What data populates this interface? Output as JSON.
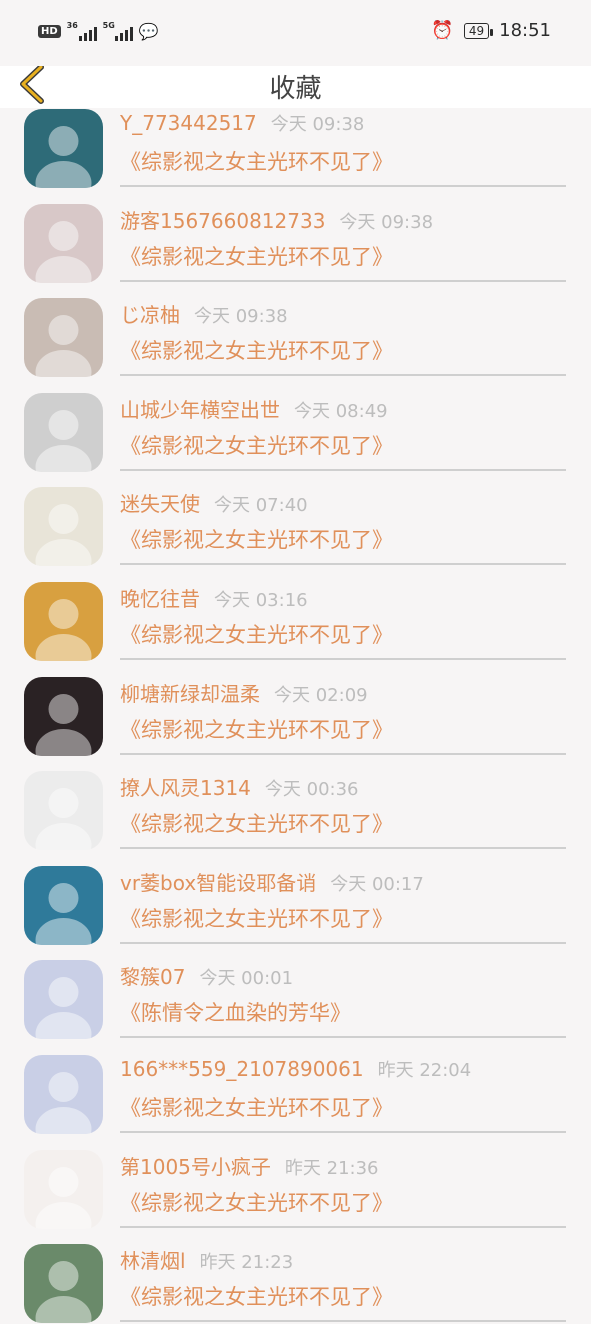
{
  "status_bar": {
    "hd": "HD",
    "sim1": "36",
    "sim2": "5G",
    "battery": "49",
    "time": "18:51"
  },
  "header": {
    "title": "收藏"
  },
  "items": [
    {
      "name": "Y_773442517",
      "time": "今天 09:38",
      "book": "《综影视之女主光环不见了》",
      "avatar_color": "#2e6b78"
    },
    {
      "name": "游客1567660812733",
      "time": "今天 09:38",
      "book": "《综影视之女主光环不见了》",
      "avatar_color": "#d8c8c8"
    },
    {
      "name": "じ凉柚",
      "time": "今天 09:38",
      "book": "《综影视之女主光环不见了》",
      "avatar_color": "#c9bcb4"
    },
    {
      "name": "山城少年横空出世",
      "time": "今天 08:49",
      "book": "《综影视之女主光环不见了》",
      "avatar_color": "#cfcfcf"
    },
    {
      "name": "迷失天使",
      "time": "今天 07:40",
      "book": "《综影视之女主光环不见了》",
      "avatar_color": "#e8e4d8"
    },
    {
      "name": "晚忆往昔",
      "time": "今天 03:16",
      "book": "《综影视之女主光环不见了》",
      "avatar_color": "#d8a040"
    },
    {
      "name": "柳塘新绿却温柔",
      "time": "今天 02:09",
      "book": "《综影视之女主光环不见了》",
      "avatar_color": "#2a2224"
    },
    {
      "name": "撩人风灵1314",
      "time": "今天 00:36",
      "book": "《综影视之女主光环不见了》",
      "avatar_color": "#ececec"
    },
    {
      "name": "vr萎box智能设耶备诮",
      "time": "今天 00:17",
      "book": "《综影视之女主光环不见了》",
      "avatar_color": "#2f7a9a"
    },
    {
      "name": "黎簇07",
      "time": "今天 00:01",
      "book": "《陈情令之血染的芳华》",
      "avatar_color": "#c9cfe6"
    },
    {
      "name": "166***559_2107890061",
      "time": "昨天 22:04",
      "book": "《综影视之女主光环不见了》",
      "avatar_color": "#c9cfe6"
    },
    {
      "name": "第1005号小疯子",
      "time": "昨天 21:36",
      "book": "《综影视之女主光环不见了》",
      "avatar_color": "#f4f0ee"
    },
    {
      "name": "林清烟l",
      "time": "昨天 21:23",
      "book": "《综影视之女主光环不见了》",
      "avatar_color": "#6a8a6a"
    }
  ],
  "colors": {
    "accent": "#e0905a",
    "back_icon": "#e8b020"
  }
}
